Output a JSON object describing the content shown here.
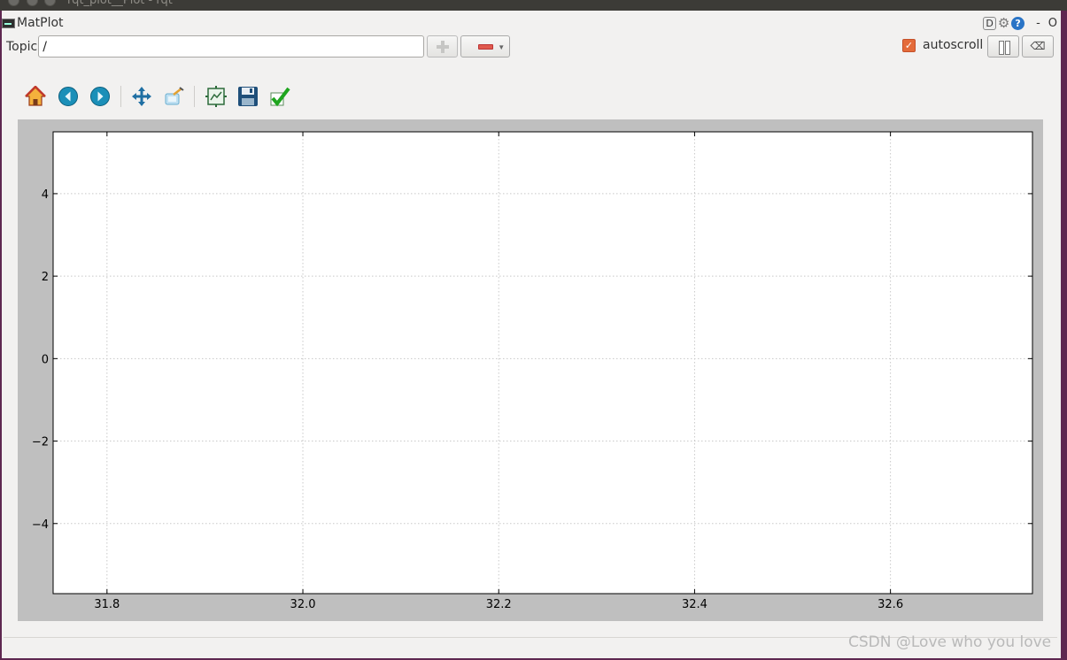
{
  "window": {
    "title": "rqt_plot__Plot - rqt"
  },
  "plugin": {
    "title": "MatPlot",
    "header_controls": {
      "d_label": "D",
      "help_label": "?",
      "minimize_label": "-",
      "close_label": "O"
    }
  },
  "topic_bar": {
    "label": "Topic",
    "value": "/",
    "autoscroll_label": "autoscroll",
    "autoscroll_checked": true
  },
  "toolbar": {
    "icons": [
      "home-icon",
      "back-icon",
      "forward-icon",
      "pan-icon",
      "zoom-icon",
      "subplots-icon",
      "save-icon",
      "edit-curves-icon"
    ]
  },
  "chart_data": {
    "type": "line",
    "title": "",
    "xlabel": "",
    "ylabel": "",
    "series": [],
    "xlim": [
      31.745,
      32.745
    ],
    "ylim": [
      -5.7,
      5.5
    ],
    "xticks": [
      31.8,
      32.0,
      32.2,
      32.4,
      32.6
    ],
    "xtick_labels": [
      "31.8",
      "32.0",
      "32.2",
      "32.4",
      "32.6"
    ],
    "yticks": [
      4,
      2,
      0,
      -2,
      -4
    ],
    "ytick_labels": [
      "4",
      "2",
      "0",
      "−2",
      "−4"
    ],
    "grid": true
  },
  "watermark": "CSDN @Love who you love",
  "colors": {
    "accent": "#e46b3a",
    "plot_background": "#ffffff",
    "figure_background": "#bfbfbf"
  }
}
